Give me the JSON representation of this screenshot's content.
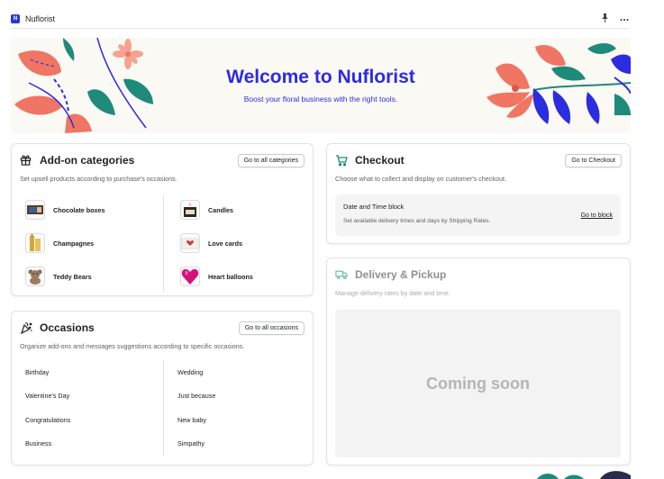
{
  "app": {
    "title": "Nuflorist",
    "logo_text": "N",
    "pin_icon": "pin-icon",
    "more_icon": "more-horizontal-icon"
  },
  "banner": {
    "title": "Welcome to Nuflorist",
    "subtitle": "Boost your floral business with the right tools."
  },
  "addon": {
    "title": "Add-on categories",
    "button": "Go to all categories",
    "description": "Set upsell products according to purchase's occasions.",
    "icon": "gift-icon",
    "categories_left": [
      "Chocolate boxes",
      "Champagnes",
      "Teddy Bears"
    ],
    "categories_right": [
      "Candles",
      "Love cards",
      "Heart balloons"
    ]
  },
  "occasions": {
    "title": "Occasions",
    "button": "Go to all occasions",
    "description": "Organize add-ons and messages suggestions according to specific occasions.",
    "icon": "confetti-icon",
    "items_left": [
      "Birthday",
      "Valentine's Day",
      "Congratulations",
      "Business"
    ],
    "items_right": [
      "Wedding",
      "Just because",
      "New baby",
      "Simpathy"
    ]
  },
  "checkout": {
    "title": "Checkout",
    "button": "Go to Checkout",
    "description": "Choose what to collect and display on customer's checkout.",
    "icon": "cart-icon",
    "block_title": "Date and Time block",
    "block_description": "Set available delivery times and days by Shipping Rates.",
    "block_link": "Go to block"
  },
  "delivery": {
    "title": "Delivery & Pickup",
    "description": "Manage delivery rates by date and time.",
    "icon": "truck-icon",
    "coming_soon": "Coming soon"
  },
  "colors": {
    "brand_blue": "#2c2ce0",
    "coral": "#f07563",
    "teal": "#1e8a7a",
    "banner_bg": "#fbf9f4"
  }
}
